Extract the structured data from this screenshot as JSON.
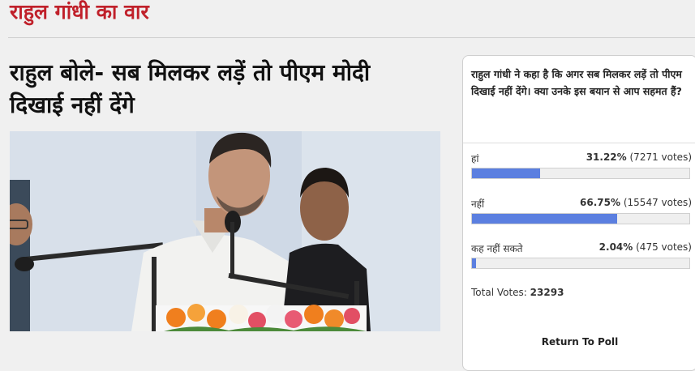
{
  "section": {
    "title": "राहुल गांधी का वार"
  },
  "article": {
    "headline_line1": "राहुल बोले- सब मिलकर लड़ें तो पीएम मोदी",
    "headline_line2": "दिखाई नहीं देंगे"
  },
  "poll": {
    "question": "राहुल गांधी ने कहा है कि अगर सब मिलकर लड़ें तो पीएम दिखाई नहीं देंगे। क्या उनके इस बयान से आप सहमत हैं?",
    "options": [
      {
        "label": "हां",
        "percent": "31.22%",
        "votes": "(7271 votes)",
        "fraction": 0.3122
      },
      {
        "label": "नहीं",
        "percent": "66.75%",
        "votes": "(15547 votes)",
        "fraction": 0.6675
      },
      {
        "label": "कह नहीं सकते",
        "percent": "2.04%",
        "votes": "(475 votes)",
        "fraction": 0.0204
      }
    ],
    "total_label": "Total Votes:",
    "total_value": "23293",
    "return_label": "Return To Poll",
    "bar_color": "#5b7fe0"
  },
  "colors": {
    "accent": "#c0202a"
  }
}
